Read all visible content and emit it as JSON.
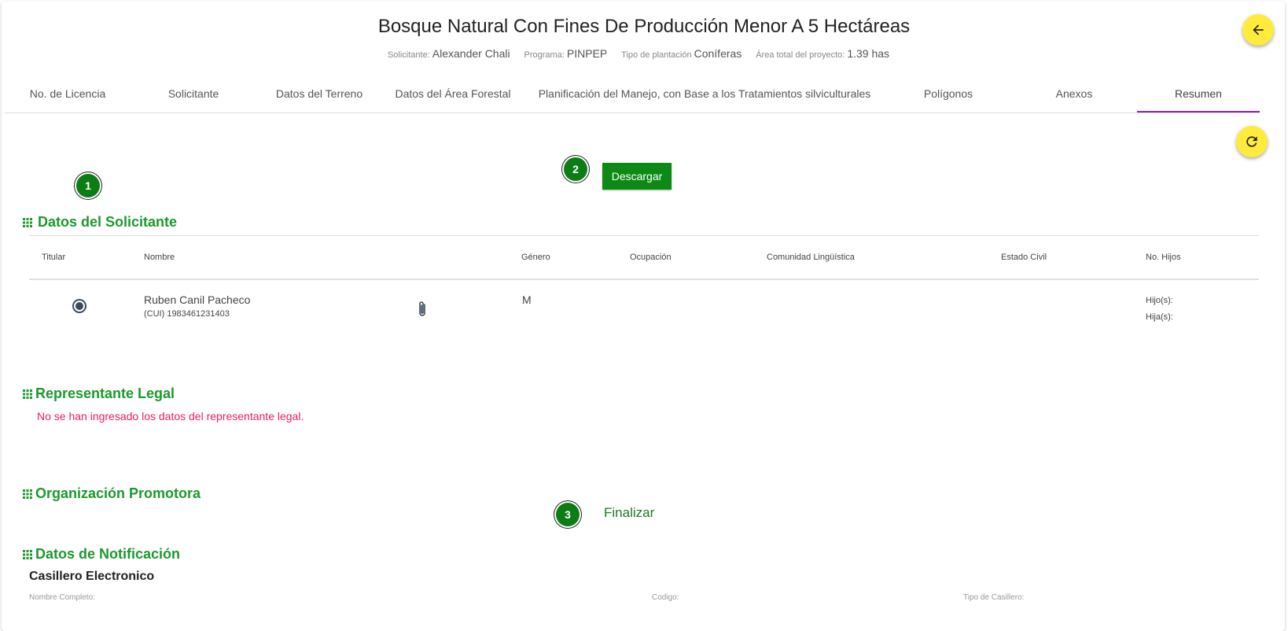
{
  "header": {
    "title": "Bosque Natural Con Fines De Producción Menor A 5 Hectáreas",
    "solicitante_label": "Solicitante:",
    "solicitante_value": "Alexander Chali",
    "programa_label": "Programa:",
    "programa_value": "PINPEP",
    "tipo_label": "Tipo de plantación",
    "tipo_value": "Coníferas",
    "area_label": "Área total del proyecto:",
    "area_value": "1.39 has"
  },
  "tabs": [
    {
      "label": "No. de Licencia"
    },
    {
      "label": "Solicitante"
    },
    {
      "label": "Datos del Terreno"
    },
    {
      "label": "Datos del Área Forestal"
    },
    {
      "label": "Planificación del Manejo, con Base a los Tratamientos silviculturales"
    },
    {
      "label": "Polígonos"
    },
    {
      "label": "Anexos"
    },
    {
      "label": "Resumen"
    }
  ],
  "steps": {
    "one": "1",
    "two": "2",
    "three": "3"
  },
  "download_button": "Descargar",
  "sections": {
    "solicitante": "Datos del Solicitante",
    "representante": "Representante Legal",
    "organizacion": "Organización Promotora",
    "notificacion": "Datos de Notificación"
  },
  "table": {
    "headers": [
      "Titular",
      "Nombre",
      "Género",
      "Ocupación",
      "Comunidad Lingüística",
      "Estado Civil",
      "No. Hijos"
    ],
    "row": {
      "nombre": "Ruben Canil Pacheco",
      "cui": "(CUI) 1983461231403",
      "genero": "M",
      "hijos": "Hijo(s):",
      "hijas": "Hija(s):"
    }
  },
  "representante_msg": "No se han ingresado los datos del representante legal.",
  "finalizar": "Finalizar",
  "notificacion": {
    "subtitle": "Casillero Electronico",
    "fields": [
      "Nombre Completo:",
      "Codigo:",
      "Tipo de Casillero:"
    ]
  },
  "colors": {
    "accent": "#8e24aa",
    "green": "#0d8a16",
    "fab": "#ffeb3b",
    "warn": "#e91e63"
  }
}
